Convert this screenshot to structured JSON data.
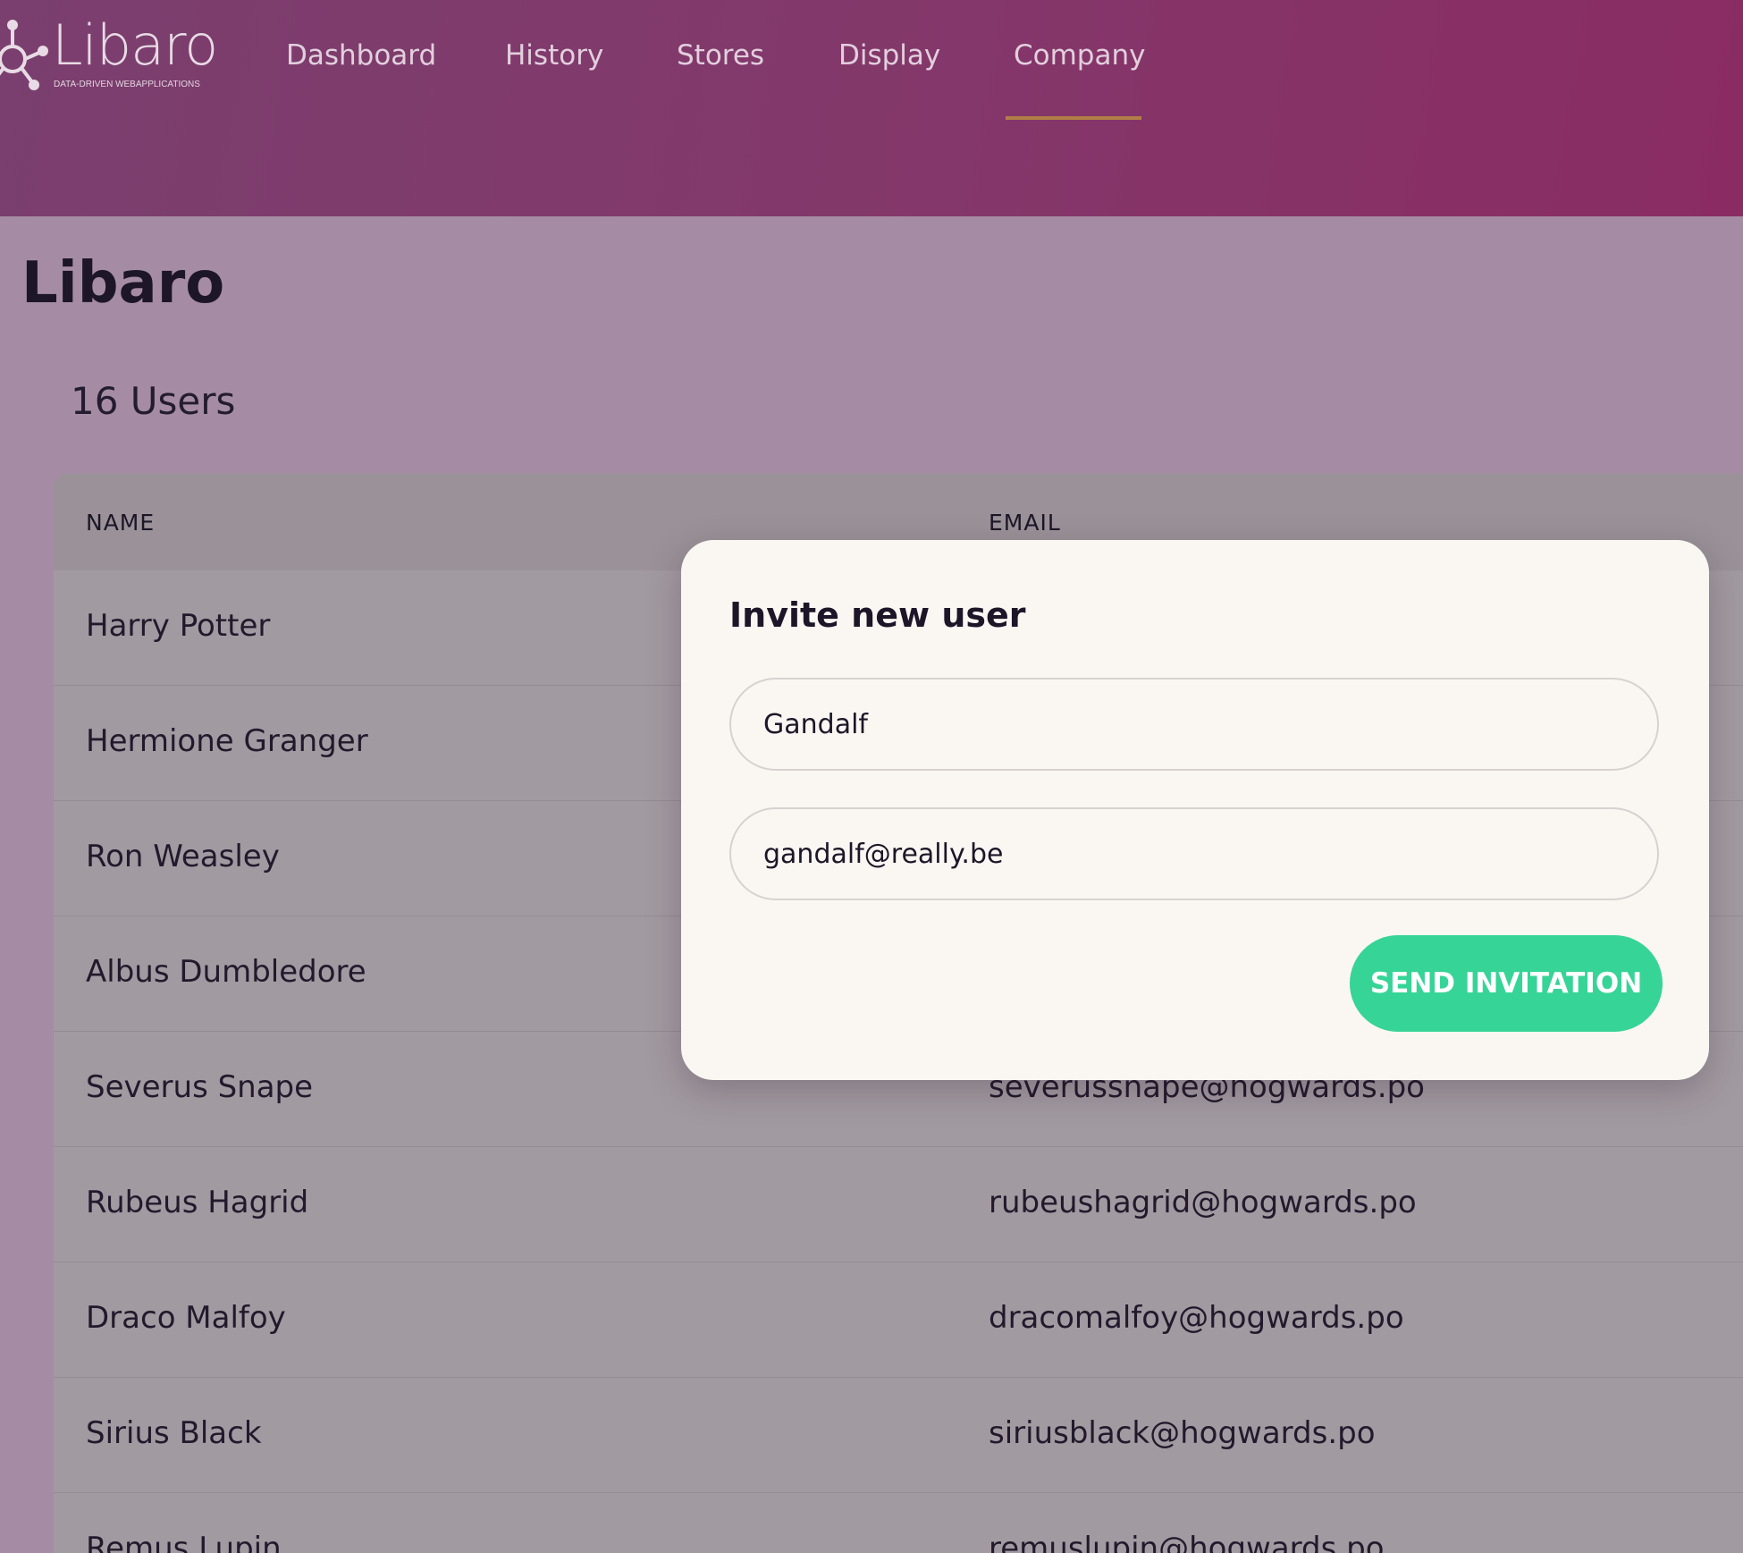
{
  "brand": {
    "logo_text": "Libaro",
    "tagline": "DATA-DRIVEN WEBAPPLICATIONS"
  },
  "nav": {
    "tabs": [
      {
        "label": "Dashboard",
        "active": false
      },
      {
        "label": "History",
        "active": false
      },
      {
        "label": "Stores",
        "active": false
      },
      {
        "label": "Display",
        "active": false
      },
      {
        "label": "Company",
        "active": true
      }
    ],
    "active_underline_color": "#b17f46"
  },
  "main": {
    "company_title": "Libaro",
    "user_count": "16 Users",
    "table": {
      "columns": [
        "NAME",
        "EMAIL"
      ],
      "rows": [
        {
          "name": "Harry Potter",
          "email": ""
        },
        {
          "name": "Hermione Granger",
          "email": ""
        },
        {
          "name": "Ron Weasley",
          "email": ""
        },
        {
          "name": "Albus Dumbledore",
          "email": ""
        },
        {
          "name": "Severus Snape",
          "email": "severussnape@hogwards.po"
        },
        {
          "name": "Rubeus Hagrid",
          "email": "rubeushagrid@hogwards.po"
        },
        {
          "name": "Draco Malfoy",
          "email": "dracomalfoy@hogwards.po"
        },
        {
          "name": "Sirius Black",
          "email": "siriusblack@hogwards.po"
        },
        {
          "name": "Remus Lupin",
          "email": "remuslupin@hogwards.po"
        }
      ]
    }
  },
  "modal": {
    "title": "Invite new user",
    "name_value": "Gandalf",
    "email_value": "gandalf@really.be",
    "send_label": "SEND INVITATION",
    "send_color": "#37d497"
  },
  "icons": {
    "logo_mark": "molecule-logo-icon"
  }
}
